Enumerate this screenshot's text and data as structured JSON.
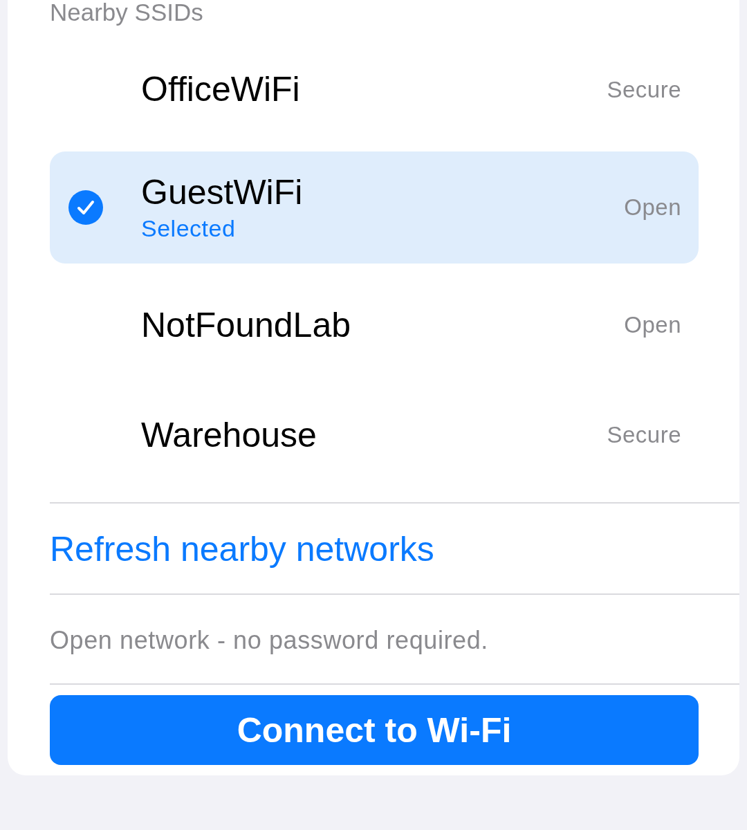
{
  "section": {
    "header": "Nearby SSIDs"
  },
  "networks": [
    {
      "name": "OfficeWiFi",
      "security": "Secure",
      "selected": false
    },
    {
      "name": "GuestWiFi",
      "subtitle": "Selected",
      "security": "Open",
      "selected": true
    },
    {
      "name": "NotFoundLab",
      "security": "Open",
      "selected": false
    },
    {
      "name": "Warehouse",
      "security": "Secure",
      "selected": false
    }
  ],
  "refresh_link": "Refresh nearby networks",
  "note": "Open network - no password required.",
  "connect_button": "Connect to Wi-Fi"
}
